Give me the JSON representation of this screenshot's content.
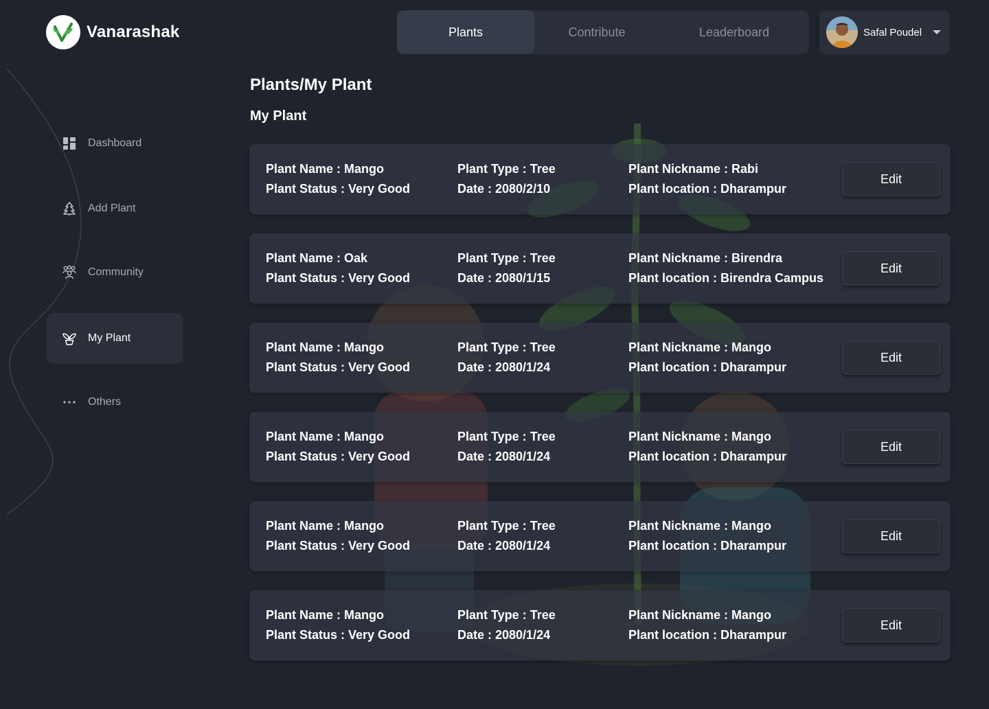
{
  "app": {
    "name": "Vanarashak"
  },
  "nav": {
    "tabs": [
      {
        "label": "Plants",
        "active": true
      },
      {
        "label": "Contribute",
        "active": false
      },
      {
        "label": "Leaderboard",
        "active": false
      }
    ]
  },
  "user": {
    "name": "Safal Poudel",
    "avatar_icon": "user-avatar"
  },
  "sidebar": {
    "items": [
      {
        "label": "Dashboard",
        "icon": "dashboard-icon"
      },
      {
        "label": "Add Plant",
        "icon": "tree-icon"
      },
      {
        "label": "Community",
        "icon": "community-icon"
      },
      {
        "label": "My Plant",
        "icon": "plant-pot-icon",
        "active": true
      },
      {
        "label": "Others",
        "icon": "more-dots-icon"
      }
    ]
  },
  "page": {
    "breadcrumb": "Plants/My Plant",
    "section_title": "My Plant"
  },
  "labels": {
    "name": "Plant Name : ",
    "status": "Plant Status : ",
    "type": "Plant Type : ",
    "date": "Date : ",
    "nickname": "Plant Nickname : ",
    "location": "Plant location : ",
    "edit": "Edit"
  },
  "plants": [
    {
      "name": "Mango",
      "status": "Very Good",
      "type": "Tree",
      "date": "2080/2/10",
      "nickname": "Rabi",
      "location": "Dharampur"
    },
    {
      "name": "Oak",
      "status": "Very Good",
      "type": "Tree",
      "date": "2080/1/15",
      "nickname": "Birendra",
      "location": "Birendra Campus"
    },
    {
      "name": "Mango",
      "status": "Very Good",
      "type": "Tree",
      "date": "2080/1/24",
      "nickname": "Mango",
      "location": "Dharampur"
    },
    {
      "name": "Mango",
      "status": "Very Good",
      "type": "Tree",
      "date": "2080/1/24",
      "nickname": "Mango",
      "location": "Dharampur"
    },
    {
      "name": "Mango",
      "status": "Very Good",
      "type": "Tree",
      "date": "2080/1/24",
      "nickname": "Mango",
      "location": "Dharampur"
    },
    {
      "name": "Mango",
      "status": "Very Good",
      "type": "Tree",
      "date": "2080/1/24",
      "nickname": "Mango",
      "location": "Dharampur"
    }
  ],
  "colors": {
    "background": "#1f232b",
    "panel": "#2a2f39",
    "accent_green": "#4caf50"
  }
}
